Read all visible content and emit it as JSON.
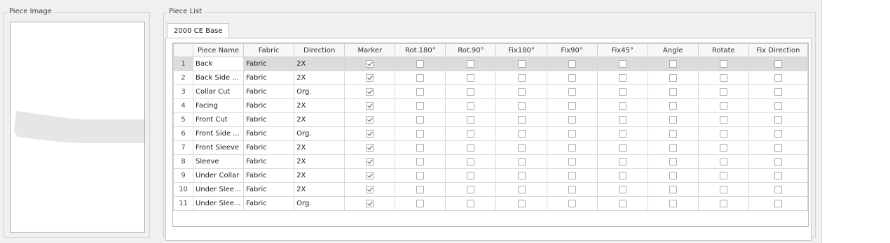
{
  "piece_image": {
    "title": "Piece Image"
  },
  "piece_list": {
    "title": "Piece List",
    "tab_label": "2000 CE Base",
    "columns": [
      "",
      "Piece Name",
      "Fabric",
      "Direction",
      "Marker",
      "Rot.180°",
      "Rot.90°",
      "Fix180°",
      "Fix90°",
      "Fix45°",
      "Angle",
      "Rotate",
      "Fix Direction"
    ],
    "selected_row": 0,
    "rows": [
      {
        "num": "1",
        "name": "Back",
        "fabric": "Fabric",
        "direction": "2X",
        "marker": true,
        "rot180": false,
        "rot90": false,
        "fix180": false,
        "fix90": false,
        "fix45": false,
        "angle": false,
        "rotate": false,
        "fixdir": false
      },
      {
        "num": "2",
        "name": "Back Side C...",
        "fabric": "Fabric",
        "direction": "2X",
        "marker": true,
        "rot180": false,
        "rot90": false,
        "fix180": false,
        "fix90": false,
        "fix45": false,
        "angle": false,
        "rotate": false,
        "fixdir": false
      },
      {
        "num": "3",
        "name": "Collar Cut",
        "fabric": "Fabric",
        "direction": "Org.",
        "marker": true,
        "rot180": false,
        "rot90": false,
        "fix180": false,
        "fix90": false,
        "fix45": false,
        "angle": false,
        "rotate": false,
        "fixdir": false
      },
      {
        "num": "4",
        "name": "Facing",
        "fabric": "Fabric",
        "direction": "2X",
        "marker": true,
        "rot180": false,
        "rot90": false,
        "fix180": false,
        "fix90": false,
        "fix45": false,
        "angle": false,
        "rotate": false,
        "fixdir": false
      },
      {
        "num": "5",
        "name": "Front Cut",
        "fabric": "Fabric",
        "direction": "2X",
        "marker": true,
        "rot180": false,
        "rot90": false,
        "fix180": false,
        "fix90": false,
        "fix45": false,
        "angle": false,
        "rotate": false,
        "fixdir": false
      },
      {
        "num": "6",
        "name": "Front Side ...",
        "fabric": "Fabric",
        "direction": "Org.",
        "marker": true,
        "rot180": false,
        "rot90": false,
        "fix180": false,
        "fix90": false,
        "fix45": false,
        "angle": false,
        "rotate": false,
        "fixdir": false
      },
      {
        "num": "7",
        "name": "Front Sleeve",
        "fabric": "Fabric",
        "direction": "2X",
        "marker": true,
        "rot180": false,
        "rot90": false,
        "fix180": false,
        "fix90": false,
        "fix45": false,
        "angle": false,
        "rotate": false,
        "fixdir": false
      },
      {
        "num": "8",
        "name": "Sleeve",
        "fabric": "Fabric",
        "direction": "2X",
        "marker": true,
        "rot180": false,
        "rot90": false,
        "fix180": false,
        "fix90": false,
        "fix45": false,
        "angle": false,
        "rotate": false,
        "fixdir": false
      },
      {
        "num": "9",
        "name": "Under Collar",
        "fabric": "Fabric",
        "direction": "2X",
        "marker": true,
        "rot180": false,
        "rot90": false,
        "fix180": false,
        "fix90": false,
        "fix45": false,
        "angle": false,
        "rotate": false,
        "fixdir": false
      },
      {
        "num": "10",
        "name": "Under Sleeve",
        "fabric": "Fabric",
        "direction": "2X",
        "marker": true,
        "rot180": false,
        "rot90": false,
        "fix180": false,
        "fix90": false,
        "fix45": false,
        "angle": false,
        "rotate": false,
        "fixdir": false
      },
      {
        "num": "11",
        "name": "Under Slee...",
        "fabric": "Fabric",
        "direction": "Org.",
        "marker": true,
        "rot180": false,
        "rot90": false,
        "fix180": false,
        "fix90": false,
        "fix45": false,
        "angle": false,
        "rotate": false,
        "fixdir": false
      }
    ]
  }
}
